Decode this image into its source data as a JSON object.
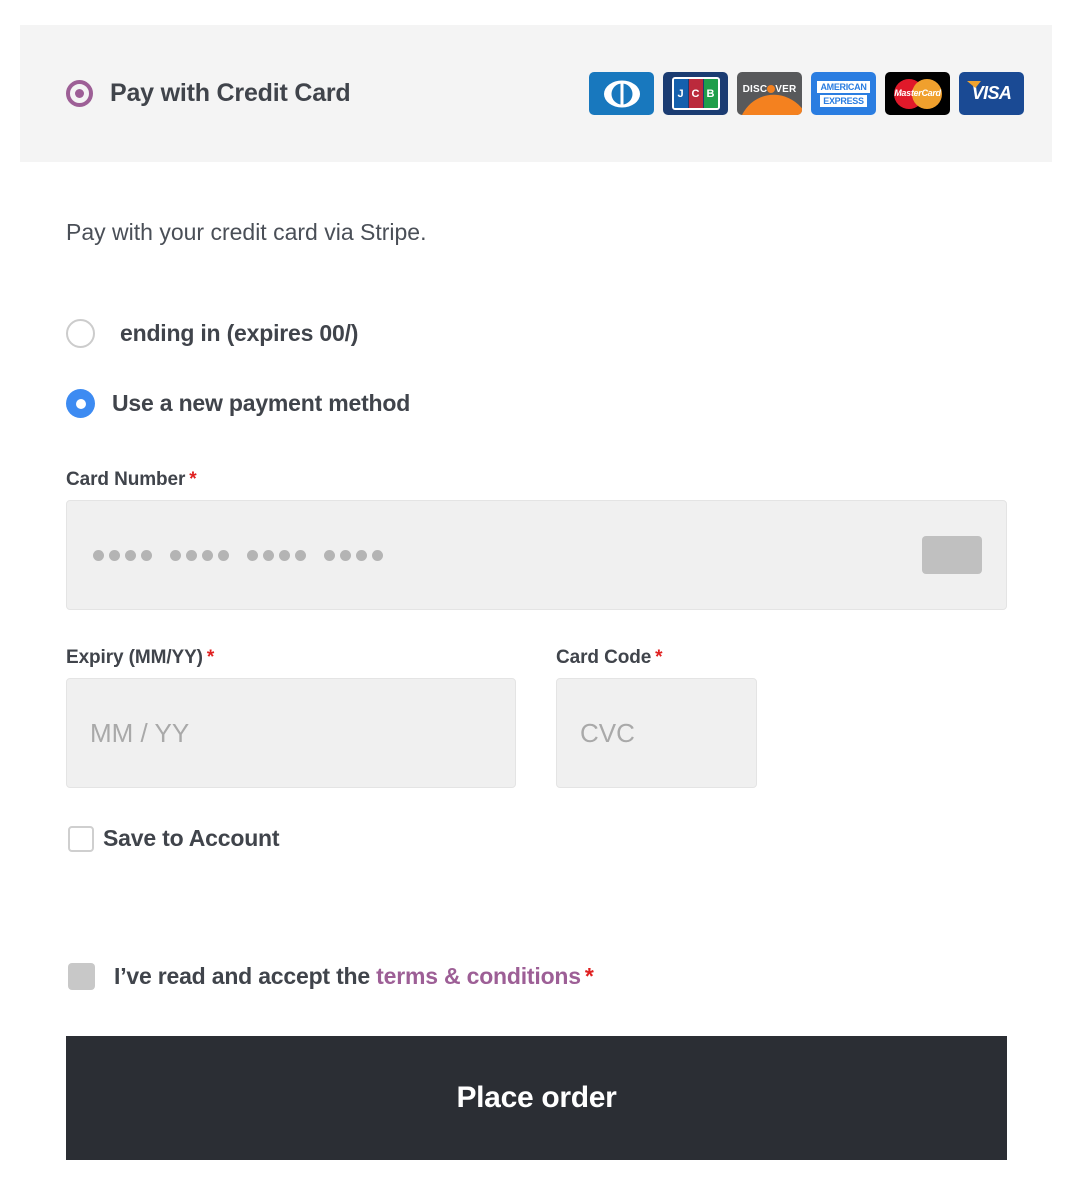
{
  "header": {
    "radio_selected": true,
    "title": "Pay with Credit Card",
    "accent_color": "#9d5f96",
    "background": "#f4f4f4",
    "card_logos": [
      {
        "name": "diners-club",
        "label": "Diners Club",
        "bg": "#1878be"
      },
      {
        "name": "jcb",
        "label": "JCB",
        "bg": "#1b3c72",
        "letters": [
          "J",
          "C",
          "B"
        ]
      },
      {
        "name": "discover",
        "label": "DISCOVER",
        "bg": "#58595b",
        "accent": "#f4811f"
      },
      {
        "name": "american-express",
        "label": "AMERICAN EXPRESS",
        "bg": "#2a7de1",
        "line1": "AMERICAN",
        "line2": "EXPRESS"
      },
      {
        "name": "mastercard",
        "label": "MasterCard",
        "bg": "#000000",
        "accent_left": "#e0192a",
        "accent_right": "#f0a02d"
      },
      {
        "name": "visa",
        "label": "VISA",
        "bg": "#1a4a94",
        "accent": "#f0a32e"
      }
    ]
  },
  "body": {
    "intro": "Pay with your credit card via Stripe.",
    "methods": [
      {
        "label": "ending in (expires 00/)",
        "selected": false
      },
      {
        "label": "Use a new payment method",
        "selected": true
      }
    ],
    "selected_color": "#3d8bf2"
  },
  "form": {
    "card_number": {
      "label": "Card Number",
      "required_mark": "*",
      "masked_value": "•••• •••• •••• ••••",
      "dot_groups": 4,
      "dots_per_group": 4,
      "brand_slot_color": "#c0c0c0"
    },
    "expiry": {
      "label": "Expiry (MM/YY)",
      "required_mark": "*",
      "placeholder": "MM / YY",
      "value": ""
    },
    "card_code": {
      "label": "Card Code",
      "required_mark": "*",
      "placeholder": "CVC",
      "value": ""
    },
    "save_to_account": {
      "label": "Save to Account",
      "checked": false
    }
  },
  "terms": {
    "prefix": "I’ve read and accept the ",
    "link": "terms & conditions",
    "required_mark": "*",
    "checked": false,
    "link_color": "#9d5f96"
  },
  "actions": {
    "place_order": "Place order",
    "button_color": "#2b2e34"
  }
}
